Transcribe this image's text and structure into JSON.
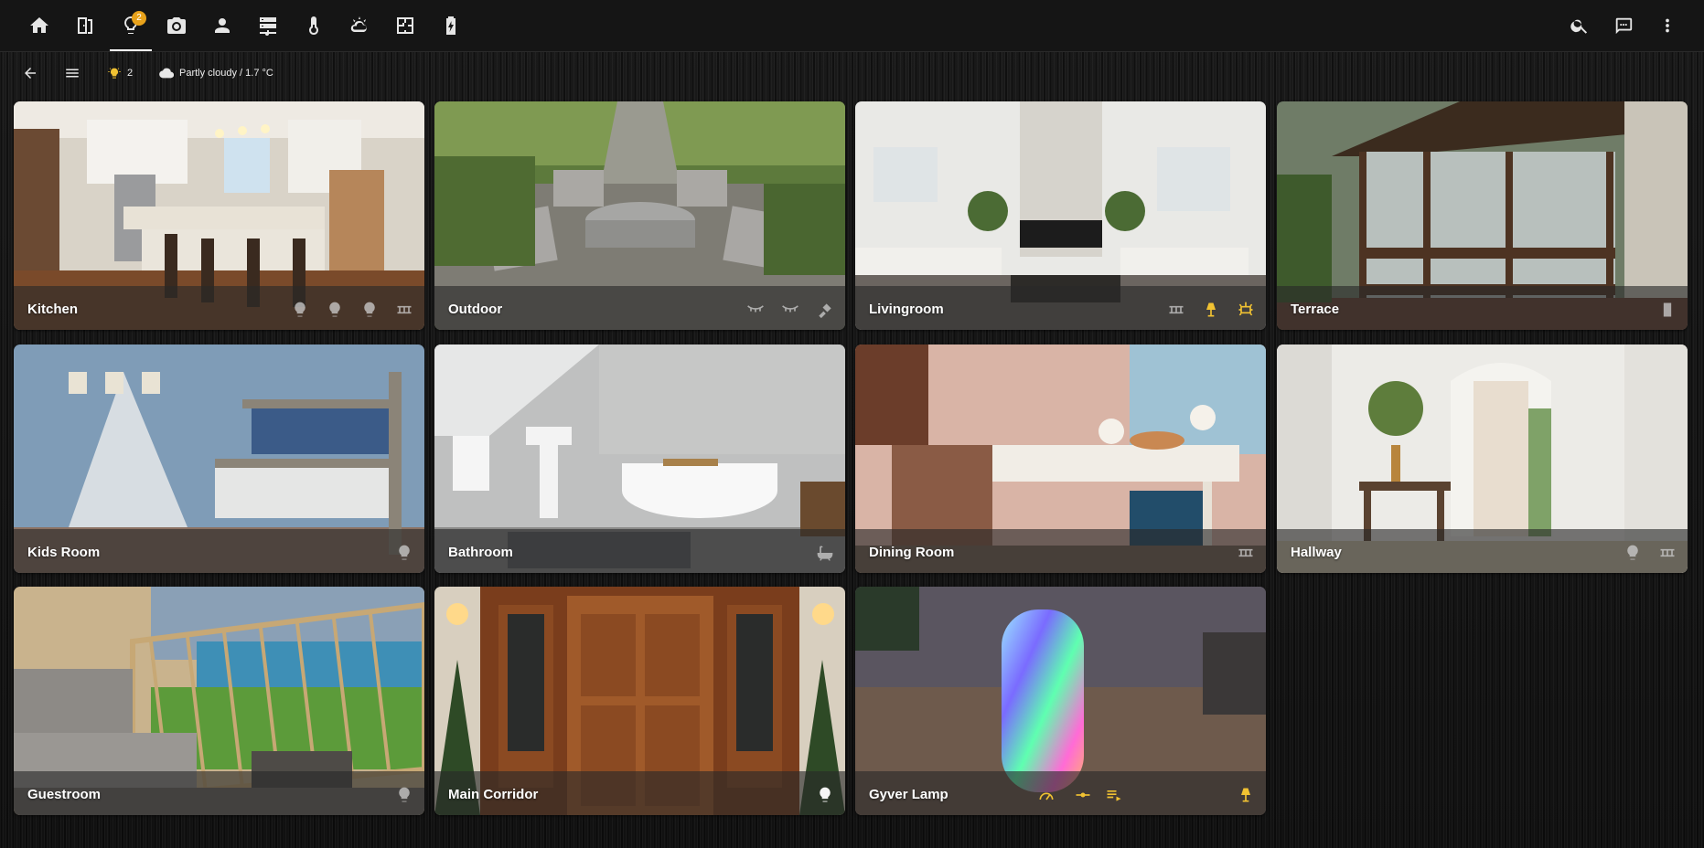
{
  "topbar": {
    "tabs": [
      {
        "name": "home-icon",
        "active": false
      },
      {
        "name": "door-icon",
        "active": false
      },
      {
        "name": "lightbulb-icon",
        "active": true,
        "badge": "2"
      },
      {
        "name": "camera-icon",
        "active": false
      },
      {
        "name": "person-icon",
        "active": false
      },
      {
        "name": "server-icon",
        "active": false
      },
      {
        "name": "thermometer-icon",
        "active": false
      },
      {
        "name": "weather-icon",
        "active": false
      },
      {
        "name": "floorplan-icon",
        "active": false
      },
      {
        "name": "battery-icon",
        "active": false
      }
    ],
    "right_icons": [
      "search-icon",
      "chat-icon",
      "more-vert-icon"
    ]
  },
  "subbar": {
    "back_icon": "arrow-left-icon",
    "menu_icon": "menu-icon",
    "lights_on_count": "2",
    "weather": "Partly cloudy / 1.7 °C"
  },
  "colors": {
    "accent": "#f1c232",
    "badge": "#e8a21b",
    "bar": "#151515"
  },
  "rooms": [
    {
      "name": "Kitchen",
      "icons": [
        {
          "i": "bulb",
          "on": false
        },
        {
          "i": "bulb",
          "on": false
        },
        {
          "i": "bulb",
          "on": false
        },
        {
          "i": "lightstrip",
          "on": false
        }
      ]
    },
    {
      "name": "Outdoor",
      "icons": [
        {
          "i": "string-lights",
          "on": false
        },
        {
          "i": "string-lights",
          "on": false
        },
        {
          "i": "spotlight",
          "on": false
        }
      ]
    },
    {
      "name": "Livingroom",
      "icons": [
        {
          "i": "lightstrip",
          "on": false
        },
        {
          "i": "lamp",
          "on": true
        },
        {
          "i": "ceiling-light",
          "on": true
        }
      ]
    },
    {
      "name": "Terrace",
      "icons": [
        {
          "i": "switch",
          "on": false
        }
      ]
    },
    {
      "name": "Kids Room",
      "icons": [
        {
          "i": "bulb",
          "on": false
        }
      ]
    },
    {
      "name": "Bathroom",
      "icons": [
        {
          "i": "bathtub",
          "on": false
        }
      ]
    },
    {
      "name": "Dining Room",
      "icons": [
        {
          "i": "lightstrip",
          "on": false
        }
      ]
    },
    {
      "name": "Hallway",
      "icons": [
        {
          "i": "bulb",
          "on": false
        },
        {
          "i": "lightstrip",
          "on": false
        }
      ]
    },
    {
      "name": "Guestroom",
      "icons": [
        {
          "i": "bulb",
          "on": false
        }
      ]
    },
    {
      "name": "Main Corridor",
      "icons": [
        {
          "i": "bulb",
          "on": "white"
        }
      ]
    },
    {
      "name": "Gyver Lamp",
      "icons": [
        {
          "i": "speed",
          "on": true
        },
        {
          "i": "slider",
          "on": true
        },
        {
          "i": "playlist",
          "on": true
        },
        {
          "i": "lamp",
          "on": true
        }
      ]
    }
  ]
}
